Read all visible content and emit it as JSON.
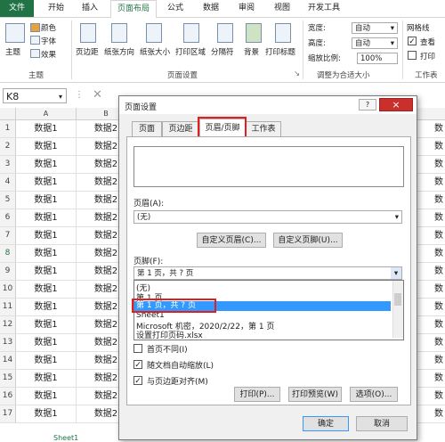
{
  "ribbon": {
    "tabs": [
      "文件",
      "开始",
      "插入",
      "页面布局",
      "公式",
      "数据",
      "审阅",
      "视图",
      "开发工具"
    ],
    "theme_group": {
      "themes": "主题",
      "colors": "颜色",
      "fonts": "字体",
      "effects": "效果",
      "label": "主题"
    },
    "page_setup_group": {
      "margins": "页边距",
      "orientation": "纸张方向",
      "size": "纸张大小",
      "print_area": "打印区域",
      "breaks": "分隔符",
      "background": "背景",
      "print_titles": "打印标题",
      "label": "页面设置"
    },
    "scale_group": {
      "width_label": "宽度:",
      "width_value": "自动",
      "height_label": "高度:",
      "height_value": "自动",
      "scale_label": "缩放比例:",
      "scale_value": "100%",
      "label": "调整为合适大小"
    },
    "sheet_options": {
      "gridlines": "网格线",
      "view": "查看",
      "print": "打印",
      "label": "工作表"
    }
  },
  "formula_bar": {
    "name_box": "K8"
  },
  "sheet": {
    "columns": [
      "A",
      "B"
    ],
    "rows": [
      {
        "num": "1",
        "a": "数据1",
        "b": "数据2",
        "r": "数"
      },
      {
        "num": "2",
        "a": "数据1",
        "b": "数据2",
        "r": "数"
      },
      {
        "num": "3",
        "a": "数据1",
        "b": "数据2",
        "r": "数"
      },
      {
        "num": "4",
        "a": "数据1",
        "b": "数据2",
        "r": "数"
      },
      {
        "num": "5",
        "a": "数据1",
        "b": "数据2",
        "r": "数"
      },
      {
        "num": "6",
        "a": "数据1",
        "b": "数据2",
        "r": "数"
      },
      {
        "num": "7",
        "a": "数据1",
        "b": "数据2",
        "r": "数"
      },
      {
        "num": "8",
        "a": "数据1",
        "b": "数据2",
        "r": "数"
      },
      {
        "num": "9",
        "a": "数据1",
        "b": "数据2",
        "r": "数"
      },
      {
        "num": "10",
        "a": "数据1",
        "b": "数据2",
        "r": "数"
      },
      {
        "num": "11",
        "a": "数据1",
        "b": "数据2",
        "r": "数"
      },
      {
        "num": "12",
        "a": "数据1",
        "b": "数据2",
        "r": "数"
      },
      {
        "num": "13",
        "a": "数据1",
        "b": "数据2",
        "r": "数"
      },
      {
        "num": "14",
        "a": "数据1",
        "b": "数据2",
        "r": "数"
      },
      {
        "num": "15",
        "a": "数据1",
        "b": "数据2",
        "r": "数"
      },
      {
        "num": "16",
        "a": "数据1",
        "b": "数据2",
        "r": "数"
      },
      {
        "num": "17",
        "a": "数据1",
        "b": "数据2",
        "r": "数"
      }
    ],
    "sheet_tab": "Sheet1"
  },
  "dialog": {
    "title": "页面设置",
    "help": "?",
    "close": "×",
    "tabs": [
      "页面",
      "页边距",
      "页眉/页脚",
      "工作表"
    ],
    "header_label": "页眉(A):",
    "header_value": "(无)",
    "custom_header": "自定义页眉(C)...",
    "custom_footer": "自定义页脚(U)...",
    "footer_label": "页脚(F):",
    "footer_value": "第 1 页，共 ? 页",
    "footer_options": [
      "(无)",
      "第 1 页",
      "第 1 页，共 ? 页",
      "Sheet1",
      "Microsoft 机密，2020/2/22，第 1 页",
      "设置打印页码.xlsx"
    ],
    "different_first": "首页不同(I)",
    "scale_with_doc": "随文档自动缩放(L)",
    "align_margins": "与页边距对齐(M)",
    "print_btn": "打印(P)...",
    "preview_btn": "打印预览(W)",
    "options_btn": "选项(O)...",
    "ok": "确定",
    "cancel": "取消"
  },
  "colors": {
    "accent": "#217346",
    "highlight": "#3399ff",
    "callout": "#e02020"
  }
}
